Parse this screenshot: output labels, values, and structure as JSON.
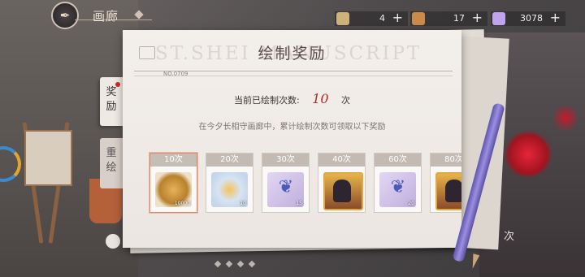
{
  "header": {
    "title": "画廊",
    "resources": [
      {
        "icon": "character-portrait-icon",
        "value": "4",
        "color": "#cdb27a"
      },
      {
        "icon": "ticket-icon",
        "value": "17",
        "color": "#c98a4a"
      },
      {
        "icon": "gem-icon",
        "value": "3078",
        "color": "#bfa4ec"
      }
    ]
  },
  "side_tabs": [
    {
      "label_top": "奖",
      "label_bottom": "励",
      "active": true
    },
    {
      "label_top": "重",
      "label_bottom": "绘",
      "active": false
    }
  ],
  "modal": {
    "title": "绘制奖励",
    "watermark": "ST.SHEI MANUSCRIPT",
    "serial": "NO.0709",
    "count_label": "当前已绘制次数:",
    "count_value": "10",
    "count_unit": "次",
    "description": "在今夕长相守画廊中，累计绘制次数可领取以下奖励",
    "rewards": [
      {
        "label": "10次",
        "item": "gold-coin-stack-icon",
        "qty": "10000"
      },
      {
        "label": "20次",
        "item": "decorated-plate-icon",
        "qty": "10"
      },
      {
        "label": "30次",
        "item": "butterfly-token-icon",
        "qty": "15"
      },
      {
        "label": "40次",
        "item": "character-portrait-icon",
        "qty": ""
      },
      {
        "label": "60次",
        "item": "butterfly-token-icon",
        "qty": "20"
      },
      {
        "label": "80次",
        "item": "character-portrait-icon",
        "qty": ""
      }
    ]
  },
  "right_panel": {
    "label": "次"
  }
}
